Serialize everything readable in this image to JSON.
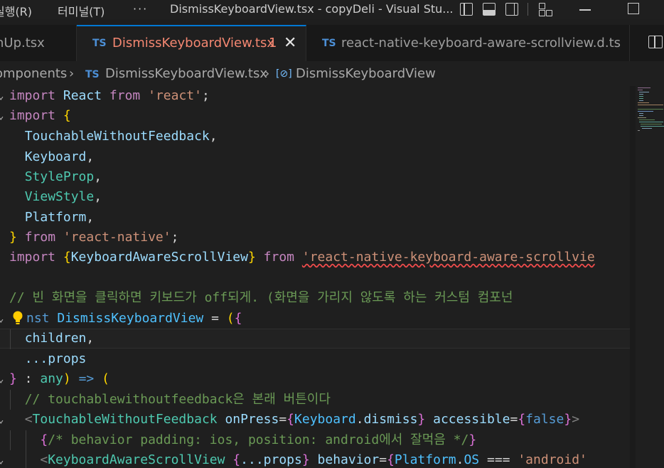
{
  "titlebar": {
    "menu_run": "실행(R)",
    "menu_terminal": "터미널(T)",
    "menu_more": "···",
    "window_title": "DismissKeyboardView.tsx - copyDeli - Visual Stu..."
  },
  "tabs": [
    {
      "badge": "",
      "label": "nUp.tsx"
    },
    {
      "badge": "TS",
      "label": "DismissKeyboardView.tsx",
      "problems": "1"
    },
    {
      "badge": "TS",
      "label": "react-native-keyboard-aware-scrollview.d.ts"
    }
  ],
  "breadcrumb": {
    "folder": "omponents",
    "chevron": "›",
    "badge": "TS",
    "file": "DismissKeyboardView.tsx",
    "symbol": "DismissKeyboardView"
  },
  "code": {
    "l1": [
      "import",
      " ",
      "React",
      " ",
      "from",
      " ",
      "'react'",
      ";"
    ],
    "l2": [
      "import",
      " ",
      "{"
    ],
    "l3": [
      "  ",
      "TouchableWithoutFeedback",
      ","
    ],
    "l4": [
      "  ",
      "Keyboard",
      ","
    ],
    "l5": [
      "  ",
      "StyleProp",
      ","
    ],
    "l6": [
      "  ",
      "ViewStyle",
      ","
    ],
    "l7": [
      "  ",
      "Platform",
      ","
    ],
    "l8": [
      "}",
      " ",
      "from",
      " ",
      "'react-native'",
      ";"
    ],
    "l9": [
      "import",
      " ",
      "{",
      "KeyboardAwareScrollView",
      "}",
      " ",
      "from",
      " ",
      "'react-native-keyboard-aware-scrollvie"
    ],
    "l11": [
      "// 빈 화면을 클릭하면 키보드가 off되게. (화면을 가리지 않도록 하는 커스텀 컴포넌"
    ],
    "l12": [
      "nst",
      " ",
      "DismissKeyboardView",
      " = ",
      "(",
      "{"
    ],
    "l13": [
      "  ",
      "children",
      ","
    ],
    "l14": [
      "  ",
      "...props"
    ],
    "l15": [
      "}",
      " : ",
      "any",
      ")",
      " ",
      "=>",
      " ",
      "("
    ],
    "l16": [
      "  ",
      "// touchablewithoutfeedback은 본래 버튼이다"
    ],
    "l17": [
      "  ",
      "<",
      "TouchableWithoutFeedback",
      " ",
      "onPress",
      "=",
      "{",
      "Keyboard",
      ".",
      "dismiss",
      "}",
      " ",
      "accessible",
      "=",
      "{",
      "false",
      "}",
      ">"
    ],
    "l18": [
      "    ",
      "{",
      "/* behavior padding: ios, position: android에서 잘먹음 */",
      "}"
    ],
    "l19": [
      "    ",
      "<",
      "KeyboardAwareScrollView",
      " ",
      "{",
      "...props",
      "}",
      " ",
      "behavior",
      "=",
      "{",
      "Platform",
      ".",
      "OS",
      " === ",
      "'android'"
    ]
  }
}
